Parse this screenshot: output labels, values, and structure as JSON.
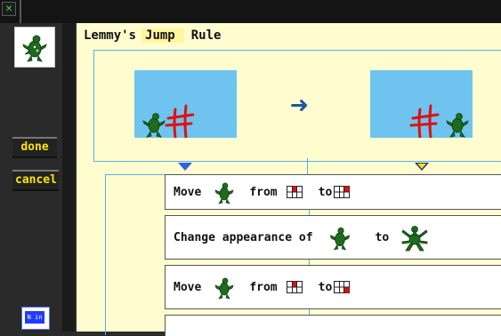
{
  "window": {
    "close_glyph": "✕"
  },
  "sidebar": {
    "done_label": "done",
    "cancel_label": "cancel",
    "mini_tile_text": "N in"
  },
  "rule": {
    "owner": "Lemmy's",
    "action_name": "Jump",
    "kind": "Rule"
  },
  "actions": [
    {
      "verb": "Move",
      "from_label": "from",
      "to_label": "to"
    },
    {
      "verb": "Change appearance of",
      "to_label": "to"
    },
    {
      "verb": "Move",
      "from_label": "from",
      "to_label": "to"
    }
  ],
  "colors": {
    "workspace": "#fffdd0",
    "scene_sky": "#6ec4ef",
    "outline": "#5aaee8",
    "button_text": "#ffe400",
    "creature": "#1e6b1e",
    "fence": "#e01010"
  }
}
